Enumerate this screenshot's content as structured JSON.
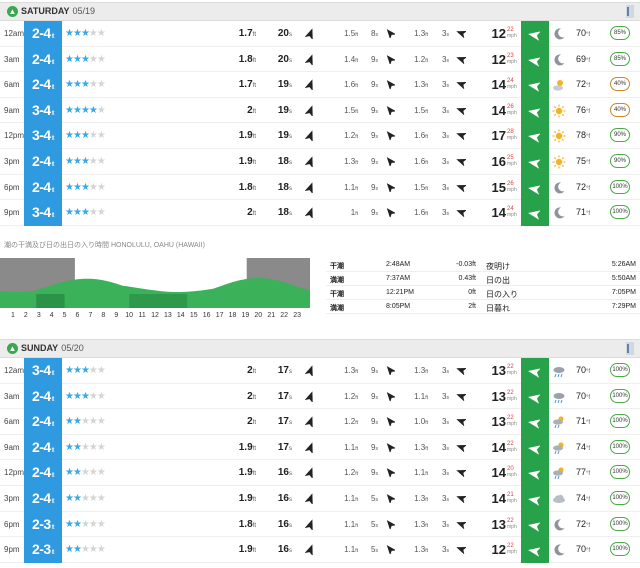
{
  "days": [
    {
      "name": "SATURDAY",
      "date": "05/19",
      "rows": [
        {
          "time": "12am",
          "surf": "2-4",
          "rating": 3,
          "sh": "1.7",
          "sp": "20",
          "sdir": 20,
          "s2h": "1.5",
          "s2p": "8",
          "s2dir": -40,
          "s3h": "1.3",
          "s3p": "3",
          "s3dir": -70,
          "wind": "12",
          "gust": "22",
          "wdir": -80,
          "wx": "moon",
          "temp": "70",
          "hum": "85%"
        },
        {
          "time": "3am",
          "surf": "2-4",
          "rating": 3,
          "sh": "1.8",
          "sp": "20",
          "sdir": 20,
          "s2h": "1.4",
          "s2p": "9",
          "s2dir": -40,
          "s3h": "1.2",
          "s3p": "3",
          "s3dir": -70,
          "wind": "12",
          "gust": "23",
          "wdir": -80,
          "wx": "moon",
          "temp": "69",
          "hum": "85%"
        },
        {
          "time": "6am",
          "surf": "2-4",
          "rating": 3,
          "sh": "1.7",
          "sp": "19",
          "sdir": 20,
          "s2h": "1.6",
          "s2p": "9",
          "s2dir": -40,
          "s3h": "1.3",
          "s3p": "3",
          "s3dir": -70,
          "wind": "14",
          "gust": "24",
          "wdir": -80,
          "wx": "sun-cloud",
          "temp": "72",
          "hum": "40%"
        },
        {
          "time": "9am",
          "surf": "3-4",
          "rating": 4,
          "sh": "2",
          "sp": "19",
          "sdir": 20,
          "s2h": "1.5",
          "s2p": "9",
          "s2dir": -40,
          "s3h": "1.5",
          "s3p": "3",
          "s3dir": -70,
          "wind": "14",
          "gust": "26",
          "wdir": -80,
          "wx": "sun",
          "temp": "76",
          "hum": "40%"
        },
        {
          "time": "12pm",
          "surf": "3-4",
          "rating": 3,
          "sh": "1.9",
          "sp": "19",
          "sdir": 20,
          "s2h": "1.2",
          "s2p": "9",
          "s2dir": -40,
          "s3h": "1.6",
          "s3p": "3",
          "s3dir": -70,
          "wind": "17",
          "gust": "28",
          "wdir": -80,
          "wx": "sun",
          "temp": "78",
          "hum": "90%"
        },
        {
          "time": "3pm",
          "surf": "2-4",
          "rating": 3,
          "sh": "1.9",
          "sp": "18",
          "sdir": 20,
          "s2h": "1.3",
          "s2p": "9",
          "s2dir": -40,
          "s3h": "1.6",
          "s3p": "3",
          "s3dir": -70,
          "wind": "16",
          "gust": "25",
          "wdir": -80,
          "wx": "sun",
          "temp": "75",
          "hum": "90%"
        },
        {
          "time": "6pm",
          "surf": "2-4",
          "rating": 3,
          "sh": "1.8",
          "sp": "18",
          "sdir": 20,
          "s2h": "1.1",
          "s2p": "9",
          "s2dir": -40,
          "s3h": "1.5",
          "s3p": "3",
          "s3dir": -70,
          "wind": "15",
          "gust": "26",
          "wdir": -80,
          "wx": "moon",
          "temp": "72",
          "hum": "100%"
        },
        {
          "time": "9pm",
          "surf": "3-4",
          "rating": 3,
          "sh": "2",
          "sp": "18",
          "sdir": 20,
          "s2h": "1",
          "s2p": "9",
          "s2dir": -40,
          "s3h": "1.6",
          "s3p": "3",
          "s3dir": -70,
          "wind": "14",
          "gust": "24",
          "wdir": -80,
          "wx": "moon",
          "temp": "71",
          "hum": "100%"
        }
      ]
    },
    {
      "name": "SUNDAY",
      "date": "05/20",
      "rows": [
        {
          "time": "12am",
          "surf": "3-4",
          "rating": 3,
          "sh": "2",
          "sp": "17",
          "sdir": 20,
          "s2h": "1.3",
          "s2p": "9",
          "s2dir": -40,
          "s3h": "1.3",
          "s3p": "3",
          "s3dir": -70,
          "wind": "13",
          "gust": "22",
          "wdir": -80,
          "wx": "moon-rain",
          "temp": "70",
          "hum": "100%"
        },
        {
          "time": "3am",
          "surf": "2-4",
          "rating": 3,
          "sh": "2",
          "sp": "17",
          "sdir": 20,
          "s2h": "1.2",
          "s2p": "9",
          "s2dir": -40,
          "s3h": "1.1",
          "s3p": "3",
          "s3dir": -70,
          "wind": "13",
          "gust": "22",
          "wdir": -80,
          "wx": "moon-rain",
          "temp": "70",
          "hum": "100%"
        },
        {
          "time": "6am",
          "surf": "2-4",
          "rating": 2,
          "sh": "2",
          "sp": "17",
          "sdir": 20,
          "s2h": "1.2",
          "s2p": "9",
          "s2dir": -40,
          "s3h": "1.0",
          "s3p": "3",
          "s3dir": -70,
          "wind": "13",
          "gust": "22",
          "wdir": -80,
          "wx": "sun-rain",
          "temp": "71",
          "hum": "100%"
        },
        {
          "time": "9am",
          "surf": "2-4",
          "rating": 2,
          "sh": "1.9",
          "sp": "17",
          "sdir": 20,
          "s2h": "1.1",
          "s2p": "9",
          "s2dir": -40,
          "s3h": "1.3",
          "s3p": "3",
          "s3dir": -70,
          "wind": "14",
          "gust": "22",
          "wdir": -80,
          "wx": "sun-rain",
          "temp": "74",
          "hum": "100%"
        },
        {
          "time": "12pm",
          "surf": "2-4",
          "rating": 2,
          "sh": "1.9",
          "sp": "16",
          "sdir": 20,
          "s2h": "1.2",
          "s2p": "9",
          "s2dir": -40,
          "s3h": "1.1",
          "s3p": "3",
          "s3dir": -70,
          "wind": "14",
          "gust": "20",
          "wdir": -80,
          "wx": "sun-rain",
          "temp": "77",
          "hum": "100%"
        },
        {
          "time": "3pm",
          "surf": "2-4",
          "rating": 2,
          "sh": "1.9",
          "sp": "16",
          "sdir": 20,
          "s2h": "1.1",
          "s2p": "5",
          "s2dir": -40,
          "s3h": "1.3",
          "s3p": "3",
          "s3dir": -70,
          "wind": "14",
          "gust": "21",
          "wdir": -80,
          "wx": "cloud",
          "temp": "74",
          "hum": "100%"
        },
        {
          "time": "6pm",
          "surf": "2-3",
          "rating": 2,
          "sh": "1.8",
          "sp": "16",
          "sdir": 20,
          "s2h": "1.1",
          "s2p": "5",
          "s2dir": -40,
          "s3h": "1.3",
          "s3p": "3",
          "s3dir": -70,
          "wind": "13",
          "gust": "22",
          "wdir": -80,
          "wx": "moon",
          "temp": "72",
          "hum": "100%"
        },
        {
          "time": "9pm",
          "surf": "2-3",
          "rating": 2,
          "sh": "1.9",
          "sp": "16",
          "sdir": 20,
          "s2h": "1.1",
          "s2p": "5",
          "s2dir": -40,
          "s3h": "1.3",
          "s3p": "3",
          "s3dir": -70,
          "wind": "12",
          "gust": "22",
          "wdir": -80,
          "wx": "moon",
          "temp": "70",
          "hum": "100%"
        }
      ]
    }
  ],
  "units": {
    "ft": "ft",
    "sec": "s",
    "mph": "mph",
    "deg": "°f"
  },
  "tide": {
    "title": "潮の干満及び日の出日の入り時間 HONOLULU, OAHU (HAWAII)",
    "hours": [
      "1",
      "2",
      "3",
      "4",
      "5",
      "6",
      "7",
      "8",
      "9",
      "10",
      "11",
      "12",
      "13",
      "14",
      "15",
      "16",
      "17",
      "18",
      "19",
      "20",
      "21",
      "22",
      "23"
    ],
    "rows": [
      {
        "label": "干潮",
        "time": "2:48AM",
        "value": "-0.03ft",
        "sun_label": "夜明け",
        "sun_time": "5:26AM"
      },
      {
        "label": "満潮",
        "time": "7:37AM",
        "value": "0.43ft",
        "sun_label": "日の出",
        "sun_time": "5:50AM"
      },
      {
        "label": "干潮",
        "time": "12:21PM",
        "value": "0ft",
        "sun_label": "日の入り",
        "sun_time": "7:05PM"
      },
      {
        "label": "満潮",
        "time": "8:05PM",
        "value": "2ft",
        "sun_label": "日暮れ",
        "sun_time": "7:29PM"
      }
    ]
  },
  "colors": {
    "surf": "#2f9ae0",
    "wind_dir": "#27a24b",
    "tide_dark": "#1f7a3a",
    "tide_light": "#3bb25a",
    "night": "#8a8a8a"
  }
}
